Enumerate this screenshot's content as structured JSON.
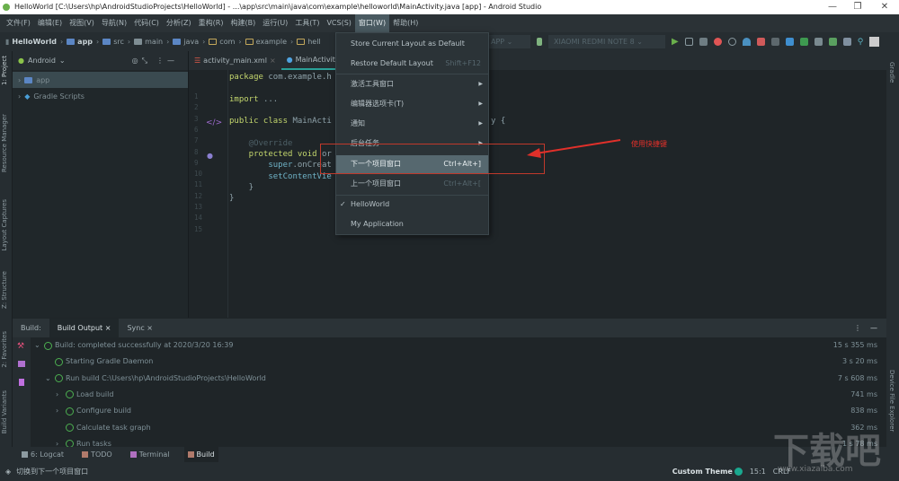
{
  "window": {
    "title": "HelloWorld [C:\\Users\\hp\\AndroidStudioProjects\\HelloWorld] - ...\\app\\src\\main\\java\\com\\example\\helloworld\\MainActivity.java [app] - Android Studio",
    "minimize": "—",
    "maximize": "❐",
    "close": "✕"
  },
  "menubar": [
    "文件(F)",
    "编辑(E)",
    "视图(V)",
    "导航(N)",
    "代码(C)",
    "分析(Z)",
    "重构(R)",
    "构建(B)",
    "运行(U)",
    "工具(T)",
    "VCS(S)",
    "窗口(W)",
    "帮助(H)"
  ],
  "breadcrumb": [
    "HelloWorld",
    "app",
    "src",
    "main",
    "java",
    "com",
    "example",
    "hell"
  ],
  "toolbar": {
    "config": "APP",
    "device": "XIAOMI REDMI NOTE 8"
  },
  "left_tabs": [
    "1: Project",
    "Resource Manager",
    "Layout Captures",
    "Z: Structure",
    "2: Favorites",
    "Build Variants"
  ],
  "right_tabs": [
    "Gradle",
    "Device File Explorer"
  ],
  "project": {
    "view": "Android",
    "tree": [
      "app",
      "Gradle Scripts"
    ]
  },
  "editor": {
    "tabs": [
      "activity_main.xml",
      "MainActivity"
    ],
    "lines": [
      {
        "n": "1",
        "parts": [
          [
            "kw",
            "package "
          ],
          [
            "",
            "com.example.h"
          ]
        ]
      },
      {
        "n": "2",
        "parts": []
      },
      {
        "n": "3",
        "parts": [
          [
            "kw",
            "import "
          ],
          [
            "",
            "..."
          ]
        ]
      },
      {
        "n": "6",
        "parts": []
      },
      {
        "n": "7",
        "parts": [
          [
            "kw",
            "public class "
          ],
          [
            "",
            "MainActi"
          ]
        ],
        "tail": "y {"
      },
      {
        "n": "8",
        "parts": []
      },
      {
        "n": "9",
        "parts": [
          [
            "ann",
            "    @Override"
          ]
        ]
      },
      {
        "n": "10",
        "parts": [
          [
            "kw",
            "    protected void "
          ],
          [
            "",
            "or"
          ]
        ],
        "tail": "ate) {"
      },
      {
        "n": "11",
        "parts": [
          [
            "fn",
            "        super"
          ],
          [
            "",
            ".onCreat"
          ]
        ]
      },
      {
        "n": "12",
        "parts": [
          [
            "fn",
            "        setContentVie"
          ]
        ]
      },
      {
        "n": "13",
        "parts": [
          [
            "",
            "    }"
          ]
        ]
      },
      {
        "n": "14",
        "parts": [
          [
            "",
            "}"
          ]
        ]
      },
      {
        "n": "15",
        "parts": []
      }
    ]
  },
  "window_menu": {
    "items": [
      {
        "label": "Store Current Layout as Default",
        "shortcut": ""
      },
      {
        "label": "Restore Default Layout",
        "shortcut": "Shift+F12"
      },
      {
        "label": "激活工具窗口",
        "submenu": true
      },
      {
        "label": "编辑器选项卡(T)",
        "submenu": true
      },
      {
        "label": "通知",
        "submenu": true
      },
      {
        "label": "后台任务",
        "submenu": true
      },
      {
        "label": "下一个项目窗口",
        "shortcut": "Ctrl+Alt+]",
        "highlighted": true
      },
      {
        "label": "上一个项目窗口",
        "shortcut": "Ctrl+Alt+["
      },
      {
        "label": "HelloWorld",
        "checked": true
      },
      {
        "label": "My Application"
      }
    ],
    "arrow": "▶",
    "check": "✓"
  },
  "annotation": {
    "text": "使用快捷键",
    "color": "#e0302a"
  },
  "build": {
    "label": "Build:",
    "tabs": [
      "Build Output",
      "Sync"
    ],
    "rows": [
      {
        "text": "Build: completed successfully at 2020/3/20 16:39",
        "dur": "15 s 355 ms",
        "indent": 0,
        "expand": "⌄"
      },
      {
        "text": "Starting Gradle Daemon",
        "dur": "3 s 20 ms",
        "indent": 1,
        "expand": ""
      },
      {
        "text": "Run build C:\\Users\\hp\\AndroidStudioProjects\\HelloWorld",
        "dur": "7 s 608 ms",
        "indent": 1,
        "expand": "⌄"
      },
      {
        "text": "Load build",
        "dur": "741 ms",
        "indent": 2,
        "expand": "›"
      },
      {
        "text": "Configure build",
        "dur": "838 ms",
        "indent": 2,
        "expand": "›"
      },
      {
        "text": "Calculate task graph",
        "dur": "362 ms",
        "indent": 2,
        "expand": ""
      },
      {
        "text": "Run tasks",
        "dur": "1 s 78 ms",
        "indent": 2,
        "expand": "›"
      }
    ]
  },
  "bottom_tabs": [
    "6: Logcat",
    "TODO",
    "Terminal",
    "Build"
  ],
  "status": {
    "message": "切换到下一个项目窗口",
    "theme": "Custom Theme",
    "position": "15:1",
    "line_ending": "CRLF"
  },
  "watermark": {
    "text": "下载吧",
    "url": "www.xiazaiba.com"
  },
  "colors": {
    "accent": "#2aa198",
    "highlight": "#56686f",
    "success": "#4caf50"
  }
}
